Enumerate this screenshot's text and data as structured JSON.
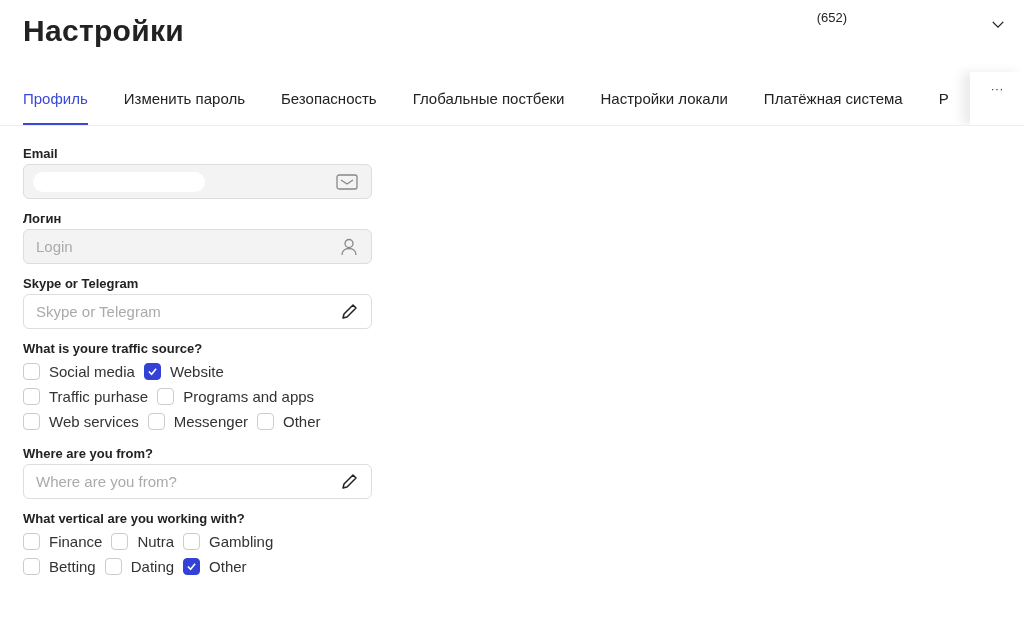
{
  "header": {
    "title": "Настройки",
    "count": "(652)"
  },
  "tabs": [
    {
      "label": "Профиль",
      "selected": true
    },
    {
      "label": "Изменить пароль",
      "selected": false
    },
    {
      "label": "Безопасность",
      "selected": false
    },
    {
      "label": "Глобальные постбеки",
      "selected": false
    },
    {
      "label": "Настройки локали",
      "selected": false
    },
    {
      "label": "Платёжная система",
      "selected": false
    },
    {
      "label": "Р",
      "selected": false
    }
  ],
  "more_tabs": "···",
  "form": [
    {
      "kind": "email",
      "label": "Email",
      "disabled": true,
      "masked": true
    },
    {
      "kind": "login",
      "label": "Логин",
      "disabled": true,
      "placeholder": "Login"
    },
    {
      "kind": "text",
      "label": "Skype or Telegram",
      "disabled": false,
      "placeholder": "Skype or Telegram"
    },
    {
      "kind": "checks",
      "label": "What is youre traffic source?",
      "rows": [
        [
          {
            "label": "Social media",
            "checked": false
          },
          {
            "label": "Website",
            "checked": true
          }
        ],
        [
          {
            "label": "Traffic purhase",
            "checked": false
          },
          {
            "label": "Programs and apps",
            "checked": false
          }
        ],
        [
          {
            "label": "Web services",
            "checked": false
          },
          {
            "label": "Messenger",
            "checked": false
          },
          {
            "label": "Other",
            "checked": false
          }
        ]
      ]
    },
    {
      "kind": "text",
      "label": "Where are you from?",
      "disabled": false,
      "placeholder": "Where are you from?"
    },
    {
      "kind": "checks",
      "label": "What vertical are you working with?",
      "rows": [
        [
          {
            "label": "Finance",
            "checked": false
          },
          {
            "label": "Nutra",
            "checked": false
          },
          {
            "label": "Gambling",
            "checked": false
          }
        ],
        [
          {
            "label": "Betting",
            "checked": false
          },
          {
            "label": "Dating",
            "checked": false
          },
          {
            "label": "Other",
            "checked": true
          }
        ]
      ]
    }
  ]
}
